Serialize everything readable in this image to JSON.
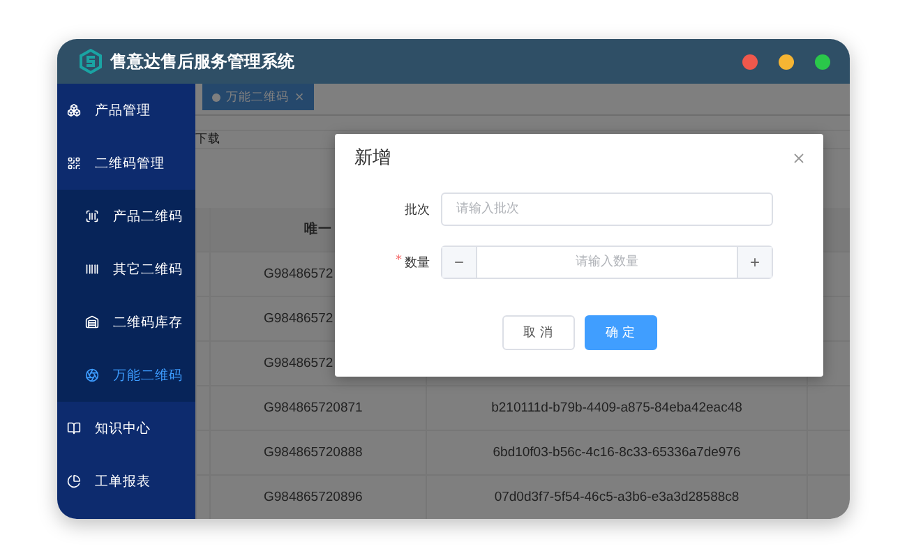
{
  "window": {
    "title": "售意达售后服务管理系统"
  },
  "sidebar": {
    "items": [
      {
        "label": "产品管理",
        "selected": false
      },
      {
        "label": "二维码管理",
        "selected": false,
        "children": [
          {
            "label": "产品二维码",
            "selected": false
          },
          {
            "label": "其它二维码",
            "selected": false
          },
          {
            "label": "二维码库存",
            "selected": false
          },
          {
            "label": "万能二维码",
            "selected": true
          }
        ]
      },
      {
        "label": "知识中心",
        "selected": false
      },
      {
        "label": "工单报表",
        "selected": false
      }
    ]
  },
  "tabs": [
    {
      "label": "万能二维码",
      "selected": true,
      "close": "×"
    }
  ],
  "toolbar": {
    "label": "下载"
  },
  "table": {
    "columns": [
      "唯一"
    ],
    "rows": [
      {
        "code": "G98486572"
      },
      {
        "code": "G98486572"
      },
      {
        "code": "G98486572"
      },
      {
        "code": "G984865720871",
        "uuid": "b210111d-b79b-4409-a875-84eba42eac48"
      },
      {
        "code": "G984865720888",
        "uuid": "6bd10f03-b56c-4c16-8c33-65336a7de976"
      },
      {
        "code": "G984865720896",
        "uuid": "07d0d3f7-5f54-46c5-a3b6-e3a3d28588c8"
      }
    ]
  },
  "dialog": {
    "title": "新增",
    "fields": [
      {
        "label": "批次",
        "kind": "text",
        "placeholder": "请输入批次"
      },
      {
        "label": "数量",
        "required_mark": "*",
        "kind": "number",
        "placeholder": "请输入数量",
        "minus": "−",
        "plus": "+"
      }
    ],
    "buttons": [
      {
        "label": "取 消",
        "primary": false
      },
      {
        "label": "确 定",
        "primary": true
      }
    ]
  }
}
